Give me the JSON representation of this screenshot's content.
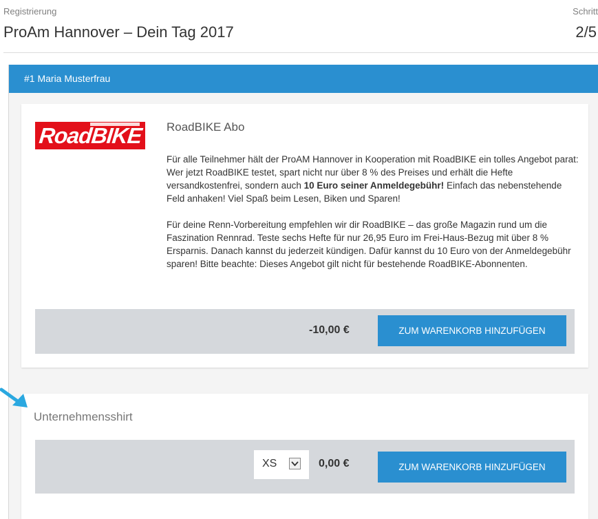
{
  "header": {
    "breadcrumb": "Registrierung",
    "title": "ProAm Hannover – Dein Tag 2017",
    "step_label": "Schritt",
    "step_value": "2/5"
  },
  "participant": {
    "header": "#1 Maria Musterfrau"
  },
  "offer": {
    "logo_text": "RoadBIKE",
    "title": "RoadBIKE Abo",
    "para1_part1": "Für alle Teilnehmer hält der ProAM Hannover in Kooperation mit RoadBIKE ein tolles Angebot parat: Wer jetzt RoadBIKE testet, spart nicht nur über 8 % des Preises und erhält die Hefte versandkostenfrei, sondern auch ",
    "para1_bold": "10 Euro seiner Anmeldegebühr!",
    "para1_part2": " Einfach das nebenstehende Feld anhaken! Viel Spaß beim Lesen, Biken und Sparen!",
    "para2": "Für deine Renn-Vorbereitung empfehlen wir dir RoadBIKE – das große Magazin rund um die Faszination Rennrad. Teste sechs Hefte für nur 26,95 Euro im Frei-Haus-Bezug mit über 8 % Ersparnis. Danach kannst du jederzeit kündigen. Dafür kannst du 10 Euro von der Anmeldegebühr sparen! Bitte beachte: Dieses Angebot gilt nicht für bestehende RoadBIKE-Abonnenten.",
    "price": "-10,00 €",
    "button_label": "ZUM WARENKORB HINZUFÜGEN"
  },
  "shirt": {
    "title": "Unternehmensshirt",
    "size_selected": "XS",
    "price": "0,00 €",
    "button_label": "ZUM WARENKORB HINZUFÜGEN"
  },
  "colors": {
    "accent": "#2a8fd0",
    "logo_red": "#e3101a",
    "cart_bar": "#d5d8dc",
    "annotation_arrow": "#2aa8e0"
  },
  "icons": {
    "dropdown": "chevron-down-icon",
    "annotation": "arrow-icon"
  }
}
